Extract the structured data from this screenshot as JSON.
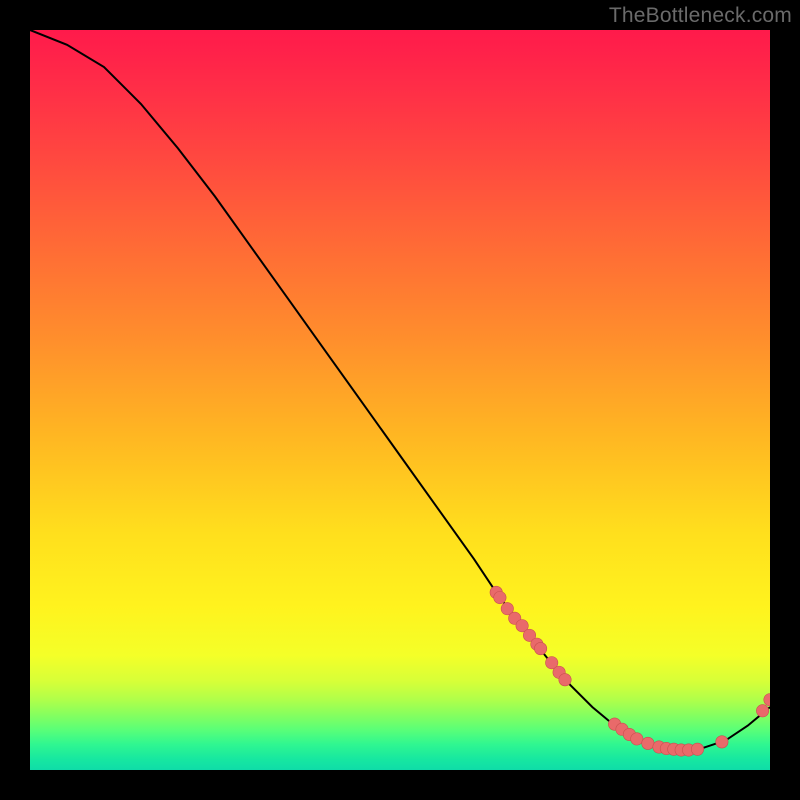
{
  "watermark": "TheBottleneck.com",
  "chart_data": {
    "type": "line",
    "title": "",
    "xlabel": "",
    "ylabel": "",
    "xlim": [
      0,
      100
    ],
    "ylim": [
      0,
      100
    ],
    "grid": false,
    "curve": {
      "name": "bottleneck-curve",
      "x": [
        0,
        5,
        10,
        15,
        20,
        25,
        30,
        35,
        40,
        45,
        50,
        55,
        60,
        63,
        66,
        70,
        73,
        76,
        79,
        82,
        85,
        88,
        91,
        94,
        97,
        100
      ],
      "y": [
        100,
        98,
        95,
        90,
        84,
        77.5,
        70.5,
        63.5,
        56.5,
        49.5,
        42.5,
        35.5,
        28.5,
        24,
        20,
        15,
        11.5,
        8.5,
        6,
        4,
        3,
        2.5,
        3,
        4,
        6,
        8.5
      ]
    },
    "points_cluster_1": {
      "name": "cluster-upper",
      "x": [
        63.0,
        63.5,
        64.5,
        65.5,
        66.5,
        67.5,
        68.5,
        69.0,
        70.5,
        71.5,
        72.3
      ],
      "y": [
        24.0,
        23.3,
        21.8,
        20.5,
        19.5,
        18.2,
        17.0,
        16.4,
        14.5,
        13.2,
        12.2
      ]
    },
    "points_cluster_2": {
      "name": "cluster-lower",
      "x": [
        79.0,
        80.0,
        81.0,
        82.0,
        83.5,
        85.0,
        86.0,
        87.0,
        88.0,
        89.0,
        90.2,
        93.5
      ],
      "y": [
        6.2,
        5.5,
        4.8,
        4.2,
        3.6,
        3.1,
        2.9,
        2.8,
        2.7,
        2.7,
        2.8,
        3.8
      ]
    },
    "point_end": {
      "x": 99.0,
      "y": 8.0
    },
    "point_end_2": {
      "x": 100.0,
      "y": 9.5
    },
    "colors": {
      "line": "#000000",
      "marker": "#e96a6a",
      "marker_stroke": "#c94f4f"
    },
    "gradient_stops": [
      {
        "offset": 0,
        "color": "#ff1a4b"
      },
      {
        "offset": 0.08,
        "color": "#ff2e47"
      },
      {
        "offset": 0.18,
        "color": "#ff4a3f"
      },
      {
        "offset": 0.3,
        "color": "#ff6d35"
      },
      {
        "offset": 0.42,
        "color": "#ff8f2c"
      },
      {
        "offset": 0.55,
        "color": "#ffb722"
      },
      {
        "offset": 0.68,
        "color": "#ffdf1d"
      },
      {
        "offset": 0.78,
        "color": "#fff31e"
      },
      {
        "offset": 0.845,
        "color": "#f4ff28"
      },
      {
        "offset": 0.88,
        "color": "#d7ff38"
      },
      {
        "offset": 0.905,
        "color": "#b0ff4a"
      },
      {
        "offset": 0.925,
        "color": "#86ff5e"
      },
      {
        "offset": 0.945,
        "color": "#5bff77"
      },
      {
        "offset": 0.965,
        "color": "#30f790"
      },
      {
        "offset": 0.985,
        "color": "#17e8a0"
      },
      {
        "offset": 1.0,
        "color": "#0fdca8"
      }
    ]
  }
}
